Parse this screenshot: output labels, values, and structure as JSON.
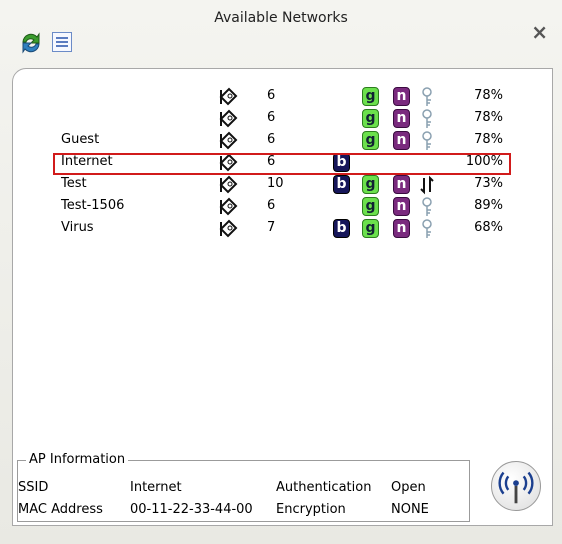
{
  "window": {
    "title": "Available Networks"
  },
  "networks": [
    {
      "ssid": "",
      "channel": "6",
      "b": false,
      "g": true,
      "n": true,
      "security": "key",
      "signal": "78%"
    },
    {
      "ssid": "",
      "channel": "6",
      "b": false,
      "g": true,
      "n": true,
      "security": "key",
      "signal": "78%"
    },
    {
      "ssid": "Guest",
      "channel": "6",
      "b": false,
      "g": true,
      "n": true,
      "security": "key",
      "signal": "78%"
    },
    {
      "ssid": "Internet",
      "channel": "6",
      "b": true,
      "g": false,
      "n": false,
      "security": "",
      "signal": "100%"
    },
    {
      "ssid": "Test",
      "channel": "10",
      "b": true,
      "g": true,
      "n": true,
      "security": "arrows",
      "signal": "73%"
    },
    {
      "ssid": "Test-1506",
      "channel": "6",
      "b": false,
      "g": true,
      "n": true,
      "security": "key",
      "signal": "89%"
    },
    {
      "ssid": "Virus",
      "channel": "7",
      "b": true,
      "g": true,
      "n": true,
      "security": "key",
      "signal": "68%"
    }
  ],
  "badges": {
    "b": "b",
    "g": "g",
    "n": "n"
  },
  "ap_info": {
    "legend": "AP Information",
    "ssid_label": "SSID",
    "ssid_value": "Internet",
    "mac_label": "MAC Address",
    "mac_value": "00-11-22-33-44-00",
    "auth_label": "Authentication",
    "auth_value": "Open",
    "enc_label": "Encryption",
    "enc_value": "NONE"
  },
  "icons": {
    "close": "×",
    "refresh": "refresh-icon",
    "list": "list-icon",
    "signal": "signal-icon",
    "key": "key-icon",
    "wifi": "wifi-icon"
  },
  "colors": {
    "selection": "#d11b1b",
    "b": "#16165a",
    "g": "#6be04c",
    "n": "#7a2a7e"
  }
}
